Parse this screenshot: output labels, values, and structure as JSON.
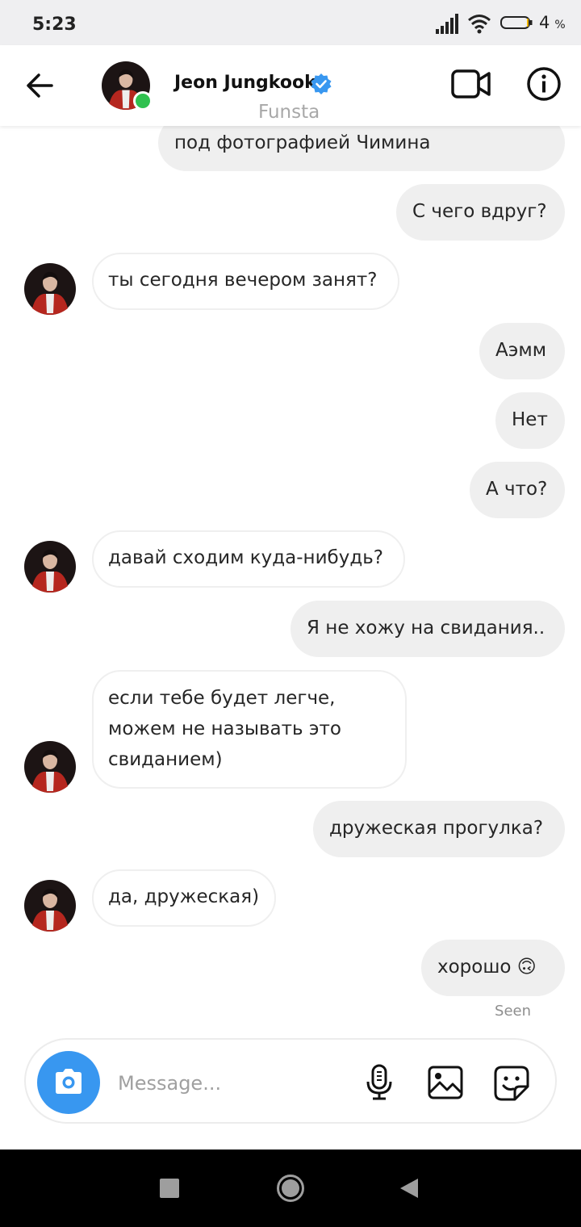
{
  "status_bar": {
    "time": "5:23",
    "battery_value": "4",
    "battery_unit": "%"
  },
  "header": {
    "name": "Jeon Jungkook",
    "subtitle": "Funsta",
    "online_color": "#2fc14f",
    "verified_color": "#3897f0",
    "icons": [
      "back-arrow-icon",
      "video-call-icon",
      "info-icon",
      "verified-badge-icon"
    ]
  },
  "messages": [
    {
      "side": "out",
      "text": "под фотографией Чимина"
    },
    {
      "side": "out",
      "text": "С чего вдруг?"
    },
    {
      "side": "in",
      "text": "ты сегодня вечером занят?"
    },
    {
      "side": "out",
      "text": "Аэмм"
    },
    {
      "side": "out",
      "text": "Нет"
    },
    {
      "side": "out",
      "text": "А что?"
    },
    {
      "side": "in",
      "text": "давай сходим куда-нибудь?"
    },
    {
      "side": "out",
      "text": "Я не хожу на свидания.."
    },
    {
      "side": "in",
      "lines": [
        "если тебе будет легче,",
        "можем не называть это",
        "свиданием)"
      ]
    },
    {
      "side": "out",
      "text": "дружеская прогулка?"
    },
    {
      "side": "in",
      "text": "да, дружеская)"
    },
    {
      "side": "out",
      "text": "хорошо 🙃"
    }
  ],
  "seen_label": "Seen",
  "composer": {
    "placeholder": "Message...",
    "value": "",
    "accent": "#3897f0",
    "icons": [
      "camera-icon",
      "microphone-icon",
      "gallery-icon",
      "sticker-icon"
    ]
  },
  "nav_bar": {
    "icons": [
      "recents-icon",
      "home-icon",
      "back-icon"
    ]
  }
}
